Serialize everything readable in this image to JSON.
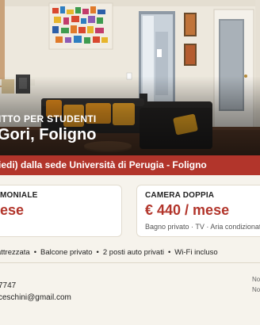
{
  "hero": {
    "kicker": "ITTO PER STUDENTI",
    "title": "Gori, Foligno"
  },
  "banner": {
    "text": "iedi) dalla sede Università di Perugia - Foligno"
  },
  "rooms": [
    {
      "type": "MONIALE",
      "price": "ese",
      "note": ""
    },
    {
      "type": "CAMERA DOPPIA",
      "price": "€ 440 / mese",
      "note": "Bagno privato · TV · Aria condizionata"
    }
  ],
  "features": {
    "items": [
      "attrezzata",
      "Balcone privato",
      "2 posti auto privati",
      "Wi-Fi incluso"
    ],
    "separator": "•"
  },
  "contact": {
    "phone": "7747",
    "email": "ceschini@gmail.com",
    "side_notes": [
      "No",
      "No"
    ]
  },
  "colors": {
    "accent": "#b2352b",
    "background": "#f6f3ec",
    "card": "#ffffff"
  }
}
